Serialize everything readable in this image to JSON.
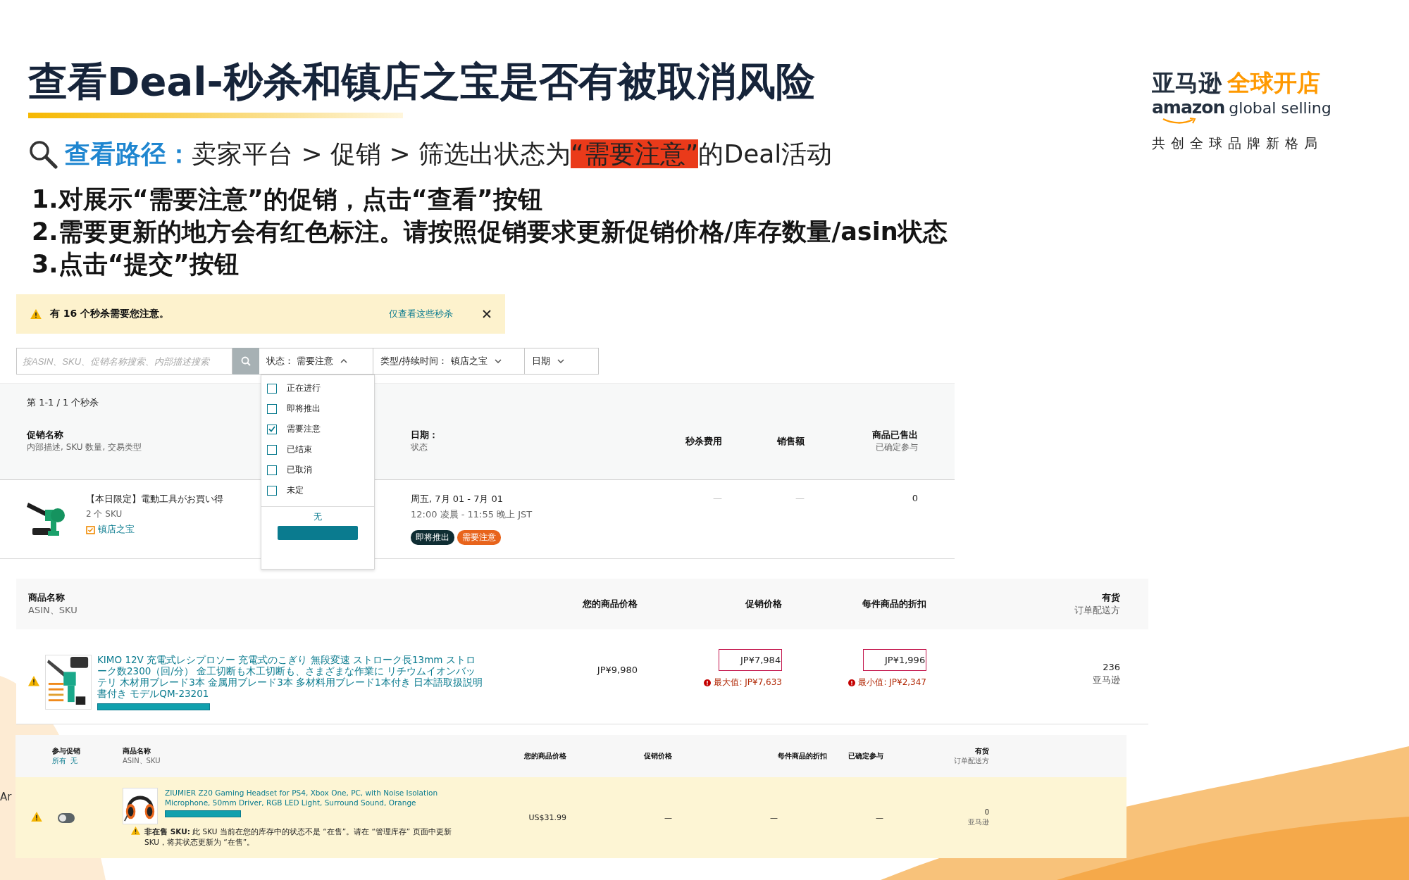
{
  "title": "查看Deal-秒杀和镇店之宝是否有被取消风险",
  "path": {
    "label": "查看路径：",
    "text": "卖家平台 > 促销 > 筛选出状态为",
    "highlight": "“需要注意”",
    "tail": "的Deal活动"
  },
  "steps": [
    "1.对展示“需要注意”的促销，点击“查看”按钮",
    "2.需要更新的地方会有红色标注。请按照促销要求更新促销价格/库存数量/asin状态",
    "3.点击“提交”按钮"
  ],
  "logo": {
    "cn_brand": "亚马逊",
    "cn_service": "全球开店",
    "en_brand": "amazon",
    "en_service": "global selling",
    "slogan": "共创全球品牌新格局"
  },
  "alert": {
    "message": "有 16 个秒杀需要您注意。",
    "link": "仅查看这些秒杀"
  },
  "filters": {
    "search_placeholder": "按ASIN、SKU、促销名称搜索、内部描述搜索",
    "dropdowns": [
      {
        "label": "状态：",
        "value": "需要注意",
        "expanded": true
      },
      {
        "label": "类型/持续时间：",
        "value": "镇店之宝",
        "expanded": false
      },
      {
        "label": "日期",
        "expanded": false
      }
    ]
  },
  "status_menu": {
    "options": [
      {
        "label": "正在进行",
        "checked": false
      },
      {
        "label": "即将推出",
        "checked": false
      },
      {
        "label": "需要注意",
        "checked": true
      },
      {
        "label": "已结束",
        "checked": false
      },
      {
        "label": "已取消",
        "checked": false
      },
      {
        "label": "未定",
        "checked": false
      }
    ],
    "clear": "无"
  },
  "deals": {
    "count": "第 1-1 / 1 个秒杀",
    "columns": [
      {
        "title": "促销名称",
        "subtitle": "内部描述, SKU 数量, 交易类型"
      },
      {
        "title": "日期：",
        "subtitle": "状态"
      },
      {
        "title": "秒杀费用"
      },
      {
        "title": "销售额"
      },
      {
        "title": "商品已售出",
        "subtitle": "已确定参与"
      }
    ],
    "rows": [
      {
        "name": "【本日限定】電動工具がお買い得",
        "sku_count": "2 个 SKU",
        "type": "镇店之宝",
        "date": "周五, 7月 01 - 7月 01",
        "time": "12:00 凌晨 - 11:55 晚上 JST",
        "badges": [
          {
            "label": "即将推出",
            "color": "#0f2d33"
          },
          {
            "label": "需要注意",
            "color": "#e8641c"
          }
        ],
        "fee": "—",
        "sales": "—",
        "sold": "0"
      }
    ]
  },
  "product_table": {
    "columns": [
      {
        "title": "商品名称",
        "subtitle": "ASIN、SKU"
      },
      {
        "title": "您的商品价格"
      },
      {
        "title": "促销价格"
      },
      {
        "title": "每件商品的折扣"
      },
      {
        "title": "有货",
        "subtitle": "订单配送方"
      }
    ],
    "rows": [
      {
        "warning": true,
        "name": "KIMO 12V 充電式レシプロソー 充電式のこぎり 無段変速 ストローク長13mm ストローク数2300（回/分） 金工切断も木工切断も、さまざまな作業に リチウムイオンバッテリ 木材用ブレード3本 金属用ブレード3本 多材料用ブレード1本付き 日本語取扱説明書付き モデルQM-23201",
        "price": "JP¥9,980",
        "promo": {
          "value": "JP¥7,984",
          "error": "最大值: JP¥7,633"
        },
        "discount": {
          "value": "JP¥1,996",
          "error": "最小值: JP¥2,347"
        },
        "stock": "236",
        "fulfillment": "亚马逊"
      }
    ]
  },
  "bottom_table": {
    "columns": [
      {
        "title": "参与促销",
        "links": [
          "所有",
          "无"
        ]
      },
      {
        "title": "商品名称",
        "subtitle": "ASIN、SKU"
      },
      {
        "title": "您的商品价格"
      },
      {
        "title": "促销价格"
      },
      {
        "title": "每件商品的折扣"
      },
      {
        "title": "已确定参与"
      },
      {
        "title": "有货",
        "subtitle": "订单配送方"
      }
    ],
    "rows": [
      {
        "warning": true,
        "participating": false,
        "name": "ZIUMIER Z20 Gaming Headset for PS4, Xbox One, PC, with Noise Isolation Microphone, 50mm Driver, RGB LED Light, Surround Sound, Orange",
        "notice": "**非在售 SKU:** 此 SKU 当前在您的库存中的状态不是 “在售”。请在 “管理库存” 页面中更新 SKU，将其状态更新为 “在售”。",
        "price": "US$31.99",
        "promo": "—",
        "discount": "—",
        "confirmed": "—",
        "stock": "0",
        "fulfillment": "亚马逊"
      }
    ]
  },
  "edge_text": "Ar"
}
